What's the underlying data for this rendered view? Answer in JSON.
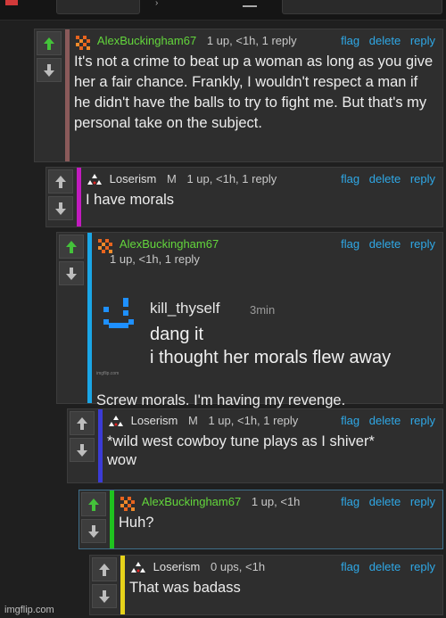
{
  "actions": {
    "flag": "flag",
    "delete": "delete",
    "reply": "reply"
  },
  "colors": {
    "green_user": "#63d63c",
    "link": "#2fa8e6"
  },
  "comments": [
    {
      "user": "AlexBuckingham67",
      "meta": "1 up, <1h, 1 reply",
      "body": "It's not a crime to beat up a woman as long as you give her a fair chance. Frankly, I wouldn't respect a man if he didn't have the balls to try to fight me. But that's my personal take on the subject.",
      "bar_color": "#8a5a5a",
      "upvoted": true
    },
    {
      "user": "Loserism",
      "badge": "M",
      "meta": "1 up, <1h, 1 reply",
      "body": "I have morals",
      "bar_color": "#c21bbf",
      "upvoted": false
    },
    {
      "user": "AlexBuckingham67",
      "meta": "1 up, <1h, 1 reply",
      "meme_user": "kill_thyself",
      "meme_time": "3min",
      "meme_line1": "dang it",
      "meme_line2": "i thought her morals flew away",
      "meme_watermark": "imgflip.com",
      "body": "Screw morals. I'm having my revenge.",
      "bar_color": "#1aa6e6",
      "upvoted": true
    },
    {
      "user": "Loserism",
      "badge": "M",
      "meta": "1 up, <1h, 1 reply",
      "body_line1": "*wild west cowboy tune plays as I shiver*",
      "body_line2": "wow",
      "bar_color": "#3b3bd6",
      "upvoted": false
    },
    {
      "user": "AlexBuckingham67",
      "meta": "1 up, <1h",
      "body": "Huh?",
      "bar_color": "#1fc21f",
      "upvoted": true
    },
    {
      "user": "Loserism",
      "meta": "0 ups, <1h",
      "body": "That was badass",
      "bar_color": "#e6d21a",
      "upvoted": false
    }
  ],
  "watermark": "imgflip.com"
}
